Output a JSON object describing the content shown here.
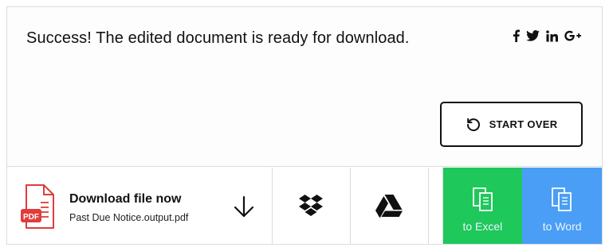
{
  "message": "Success! The edited document is ready for download.",
  "social": [
    {
      "name": "facebook-icon",
      "glyph": "f"
    },
    {
      "name": "twitter-icon",
      "glyph": ""
    },
    {
      "name": "linkedin-icon",
      "glyph": "in"
    },
    {
      "name": "google-plus-icon",
      "glyph": "G+"
    }
  ],
  "start_over": {
    "label": "START OVER",
    "icon": "restart-icon"
  },
  "download": {
    "title": "Download file now",
    "filename": "Past Due Notice.output.pdf",
    "file_icon_label": "PDF",
    "icon": "arrow-down-icon"
  },
  "cloud": [
    {
      "name": "dropbox-icon"
    },
    {
      "name": "google-drive-icon"
    }
  ],
  "convert": [
    {
      "label": "to Excel",
      "color": "#1ec85a",
      "icon": "document-copy-icon"
    },
    {
      "label": "to Word",
      "color": "#4a9ef5",
      "icon": "document-copy-icon"
    }
  ],
  "colors": {
    "pdf": "#e03c3c",
    "border": "#dcdcdc",
    "text": "#111111"
  }
}
